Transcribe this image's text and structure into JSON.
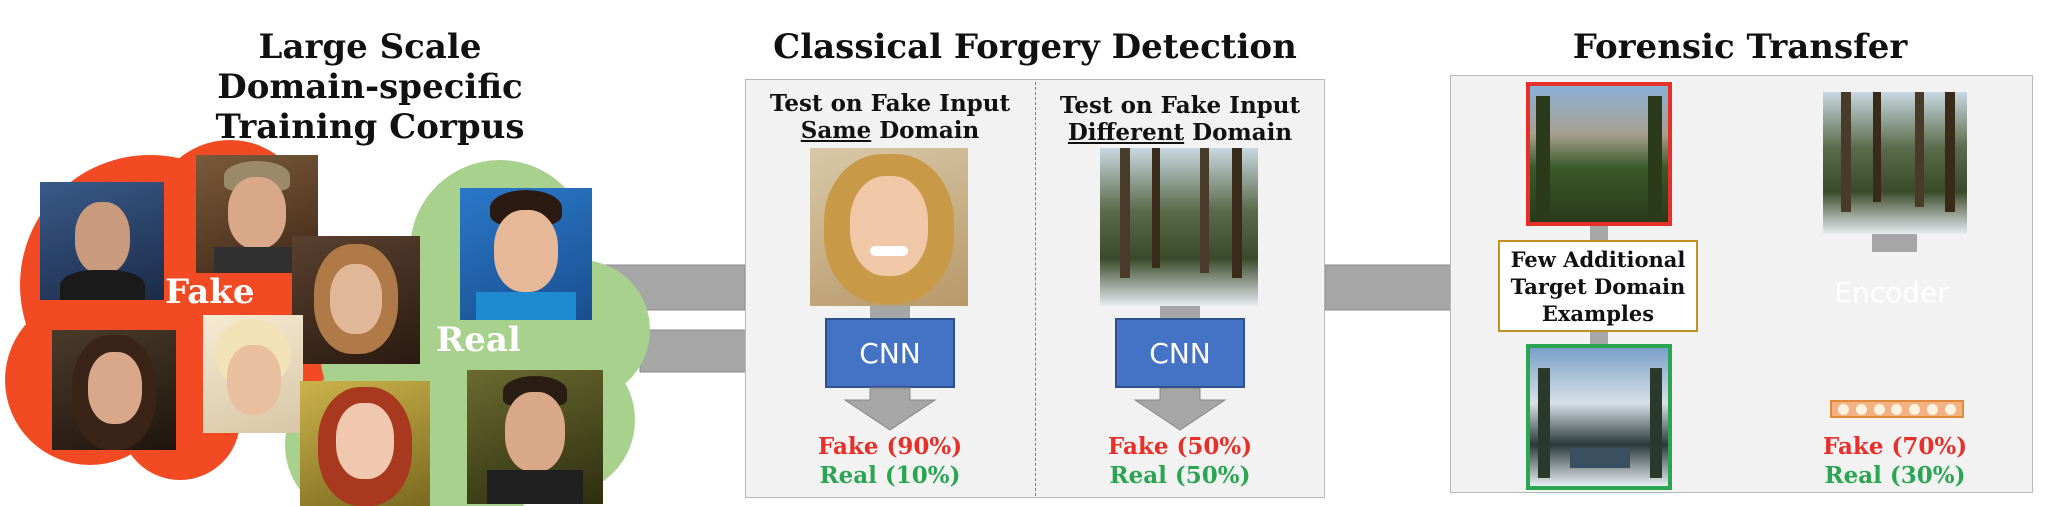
{
  "left": {
    "title_lines": [
      "Large Scale",
      "Domain-specific",
      "Training Corpus"
    ],
    "fake_label": "Fake",
    "real_label": "Real"
  },
  "middle": {
    "title": "Classical Forgery Detection",
    "col1": {
      "line1": "Test on Fake Input",
      "line2_u": "Same",
      "line2_rest": " Domain",
      "model": "CNN",
      "fake": "Fake (90%)",
      "real": "Real (10%)"
    },
    "col2": {
      "line1": "Test on Fake Input",
      "line2_u": "Different",
      "line2_rest": " Domain",
      "model": "CNN",
      "fake": "Fake (50%)",
      "real": "Real (50%)"
    }
  },
  "right": {
    "title": "Forensic Transfer",
    "examples_label": [
      "Few Additional",
      "Target Domain",
      "Examples"
    ],
    "model": "Encoder",
    "fake": "Fake (70%)",
    "real": "Real (30%)"
  },
  "colors": {
    "fake_red": "#e8302a",
    "real_green": "#2aa551",
    "cloud_red": "#f24a22",
    "cloud_green": "#a9d18e",
    "cnn_blue": "#4472c4",
    "arrow_gray": "#a6a6a6",
    "latent_orange": "#f4b183"
  }
}
